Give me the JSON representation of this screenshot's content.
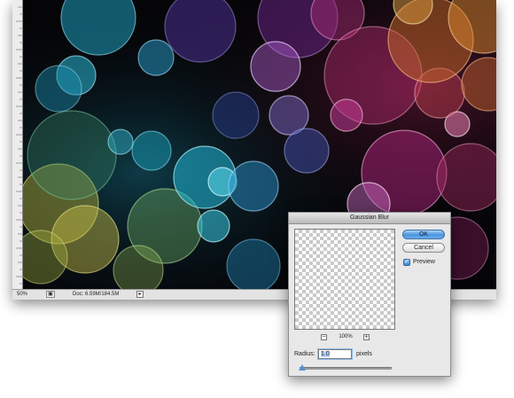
{
  "document": {
    "zoom": "50%",
    "doc_info": "Doc: 6.59M/184.5M",
    "status_icon": "layers-icon",
    "menu_arrow": "▸"
  },
  "dialog": {
    "title": "Gaussian Blur",
    "ok_label": "OK",
    "cancel_label": "Cancel",
    "preview_label": "Preview",
    "preview_checked": true,
    "zoom_out_label": "−",
    "zoom_level": "100%",
    "zoom_in_label": "+",
    "radius_label": "Radius:",
    "radius_value": "1.0",
    "radius_unit": "pixels",
    "slider_value_fraction": 0.0
  },
  "colors": {
    "ok_button": "#4b94df",
    "canvas_background": "#050508"
  }
}
